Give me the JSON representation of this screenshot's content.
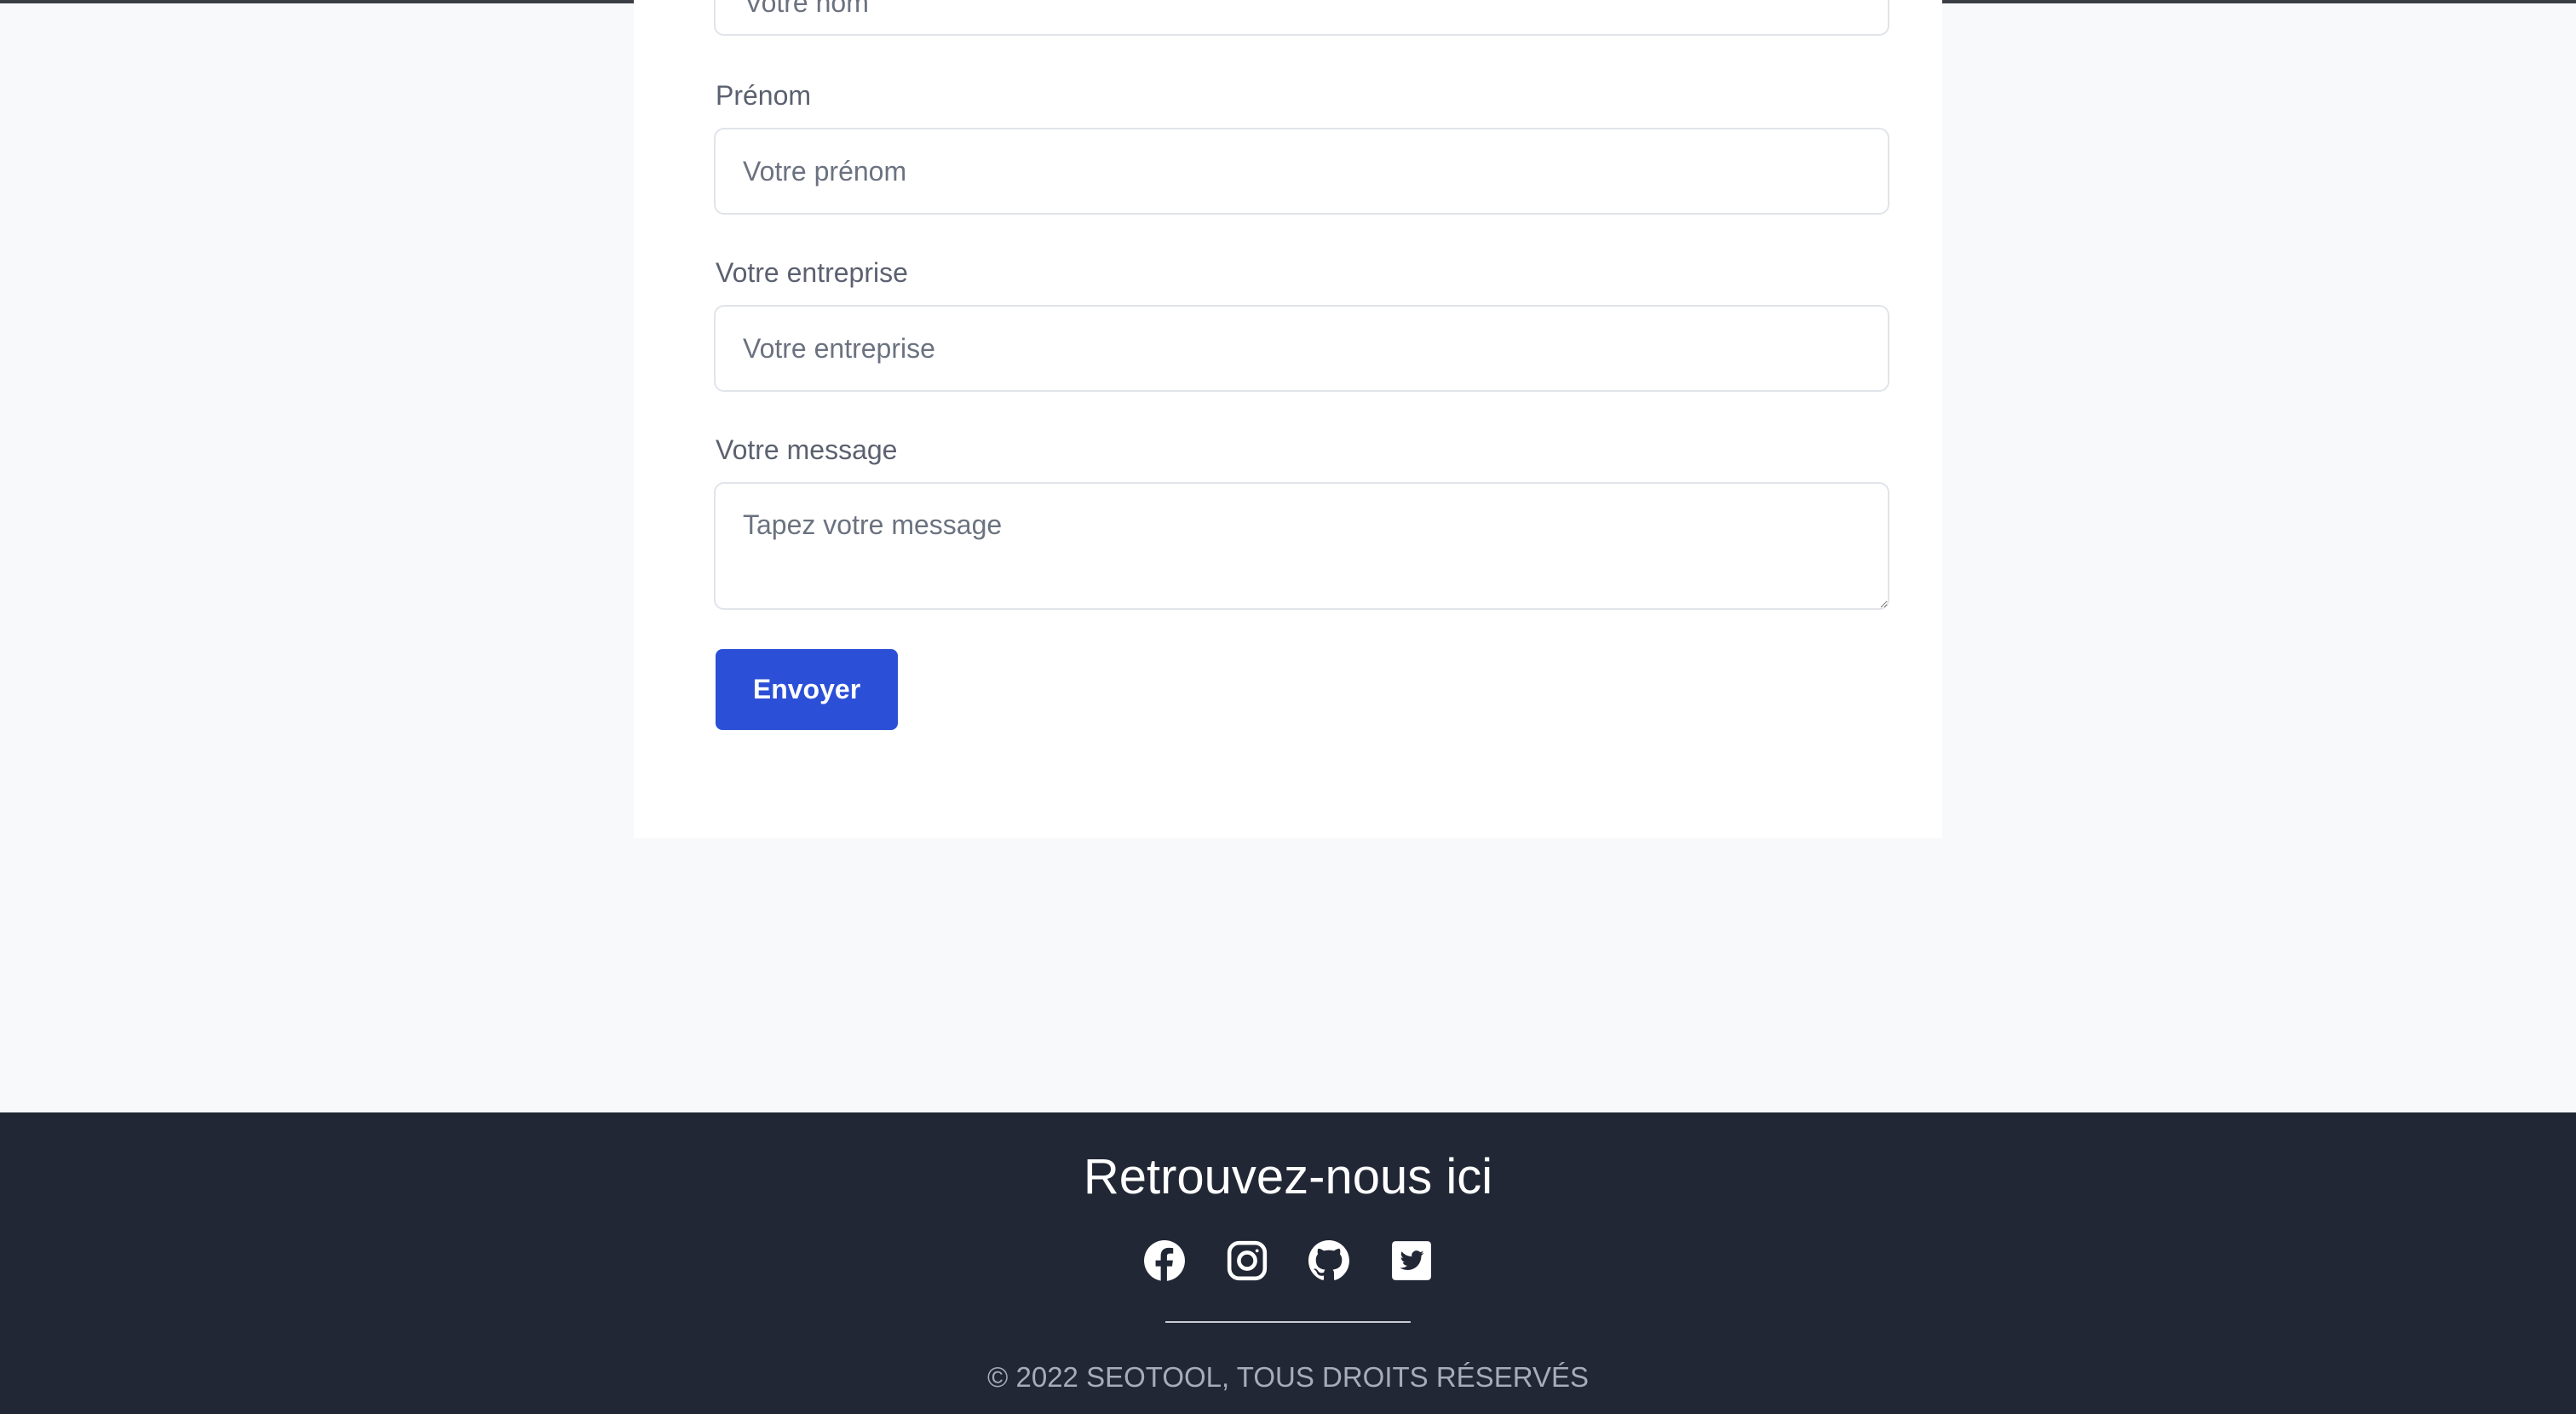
{
  "form": {
    "nom_placeholder": "Votre nom",
    "prenom_label": "Prénom",
    "prenom_placeholder": "Votre prénom",
    "entreprise_label": "Votre entreprise",
    "entreprise_placeholder": "Votre entreprise",
    "message_label": "Votre message",
    "message_placeholder": "Tapez votre message",
    "submit_label": "Envoyer"
  },
  "footer": {
    "title": "Retrouvez-nous ici",
    "socials": [
      {
        "icon": "facebook-icon"
      },
      {
        "icon": "instagram-icon"
      },
      {
        "icon": "github-icon"
      },
      {
        "icon": "twitter-icon"
      }
    ],
    "copyright": "© 2022 SEOTOOL, TOUS DROITS RÉSERVÉS"
  },
  "colors": {
    "accent": "#2b4fd6",
    "footer_bg": "#222735",
    "page_bg": "#f8f9fb"
  }
}
